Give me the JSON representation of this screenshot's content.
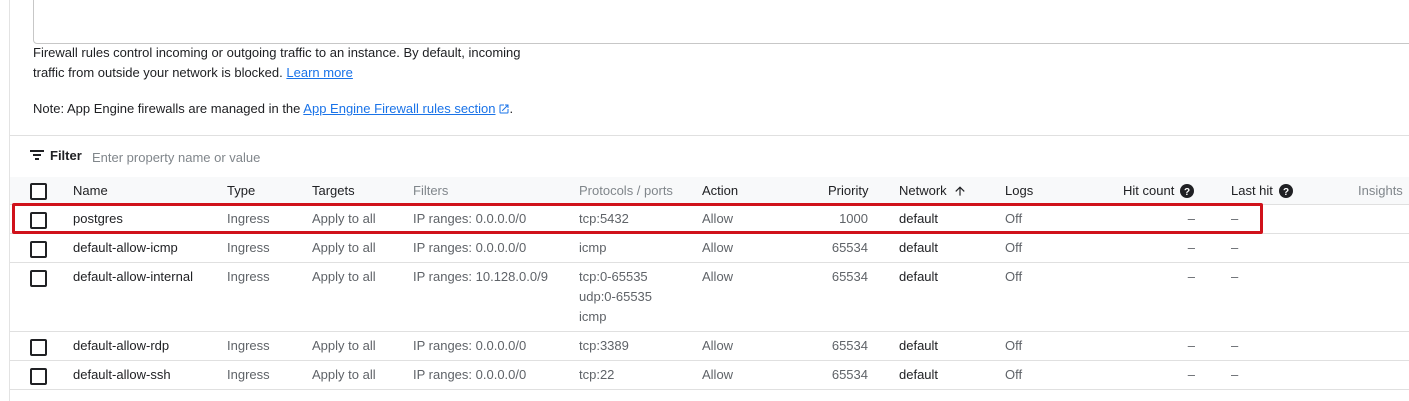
{
  "intro": {
    "text": "Firewall rules control incoming or outgoing traffic to an instance. By default, incoming traffic from outside your network is blocked.",
    "learn_more": "Learn more",
    "note_prefix": "Note: App Engine firewalls are managed in the",
    "note_link": "App Engine Firewall rules section",
    "note_suffix": "."
  },
  "filter": {
    "label": "Filter",
    "placeholder": "Enter property name or value"
  },
  "table": {
    "columns": {
      "name": "Name",
      "type": "Type",
      "targets": "Targets",
      "filters": "Filters",
      "protocols": "Protocols / ports",
      "action": "Action",
      "priority": "Priority",
      "network": "Network",
      "logs": "Logs",
      "hit_count": "Hit count",
      "last_hit": "Last hit",
      "insights": "Insights"
    },
    "rows": [
      {
        "name": "postgres",
        "type": "Ingress",
        "targets": "Apply to all",
        "filters": "IP ranges: 0.0.0.0/0",
        "protocols": [
          "tcp:5432"
        ],
        "action": "Allow",
        "priority": "1000",
        "network": "default",
        "logs": "Off",
        "hit_count": "–",
        "last_hit": "–"
      },
      {
        "name": "default-allow-icmp",
        "type": "Ingress",
        "targets": "Apply to all",
        "filters": "IP ranges: 0.0.0.0/0",
        "protocols": [
          "icmp"
        ],
        "action": "Allow",
        "priority": "65534",
        "network": "default",
        "logs": "Off",
        "hit_count": "–",
        "last_hit": "–"
      },
      {
        "name": "default-allow-internal",
        "type": "Ingress",
        "targets": "Apply to all",
        "filters": "IP ranges: 10.128.0.0/9",
        "protocols": [
          "tcp:0-65535",
          "udp:0-65535",
          "icmp"
        ],
        "action": "Allow",
        "priority": "65534",
        "network": "default",
        "logs": "Off",
        "hit_count": "–",
        "last_hit": "–"
      },
      {
        "name": "default-allow-rdp",
        "type": "Ingress",
        "targets": "Apply to all",
        "filters": "IP ranges: 0.0.0.0/0",
        "protocols": [
          "tcp:3389"
        ],
        "action": "Allow",
        "priority": "65534",
        "network": "default",
        "logs": "Off",
        "hit_count": "–",
        "last_hit": "–"
      },
      {
        "name": "default-allow-ssh",
        "type": "Ingress",
        "targets": "Apply to all",
        "filters": "IP ranges: 0.0.0.0/0",
        "protocols": [
          "tcp:22"
        ],
        "action": "Allow",
        "priority": "65534",
        "network": "default",
        "logs": "Off",
        "hit_count": "–",
        "last_hit": "–"
      }
    ]
  },
  "icons": {
    "filter": "filter-list-icon",
    "external": "open-in-new-icon",
    "sort": "arrow-up-icon",
    "help": "help-circle-icon"
  },
  "colors": {
    "link": "#1a73e8",
    "highlight": "#d0121b"
  }
}
